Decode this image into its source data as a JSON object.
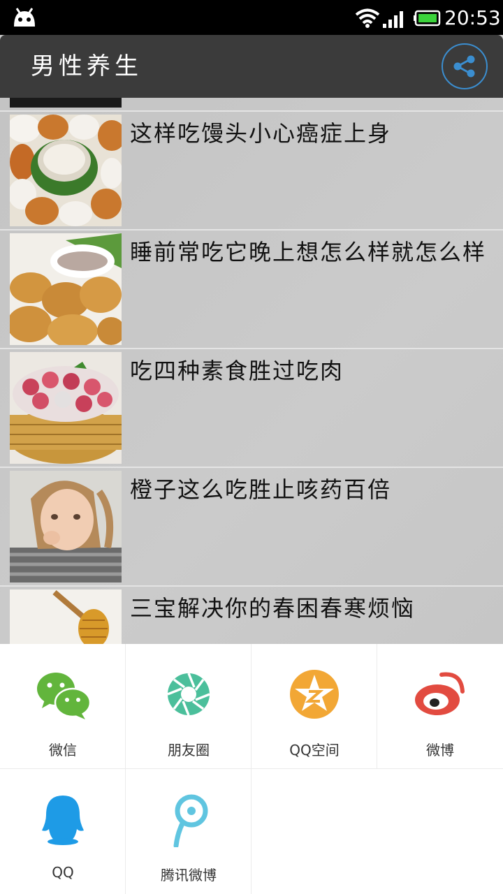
{
  "status_bar": {
    "time": "20:53"
  },
  "action_bar": {
    "title": "男性养生",
    "share_icon": "share-icon"
  },
  "articles": [
    {
      "title": "这样吃馒头小心癌症上身"
    },
    {
      "title": "睡前常吃它晚上想怎么样就怎么样"
    },
    {
      "title": "吃四种素食胜过吃肉"
    },
    {
      "title": "橙子这么吃胜止咳药百倍"
    },
    {
      "title": "三宝解决你的春困春寒烦恼"
    }
  ],
  "share_sheet": {
    "items": [
      {
        "label": "微信",
        "icon": "wechat-icon",
        "color": "#62b53c"
      },
      {
        "label": "朋友圈",
        "icon": "moments-icon",
        "color": "#4bbf9b"
      },
      {
        "label": "QQ空间",
        "icon": "qzone-icon",
        "color": "#f2a735"
      },
      {
        "label": "微博",
        "icon": "weibo-icon",
        "color": "#e24b40"
      },
      {
        "label": "QQ",
        "icon": "qq-icon",
        "color": "#1e9be6"
      },
      {
        "label": "腾讯微博",
        "icon": "tencent-weibo-icon",
        "color": "#60c5e0"
      }
    ]
  }
}
